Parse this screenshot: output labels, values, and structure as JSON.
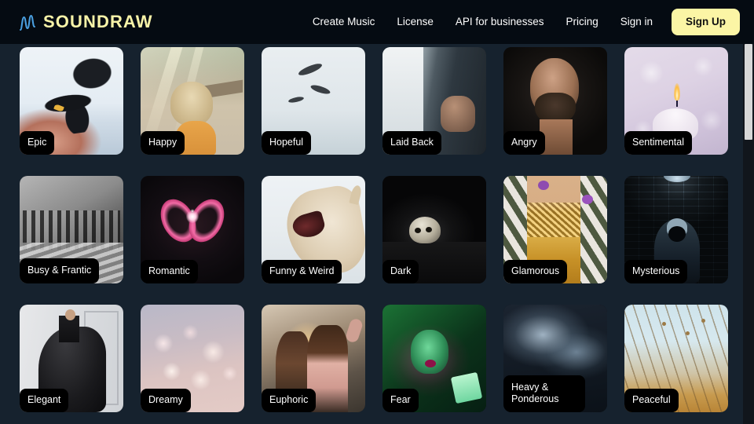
{
  "header": {
    "logo_text": "SOUNDRAW",
    "logo_mark_name": "waveform-icon",
    "nav": [
      {
        "label": "Create Music"
      },
      {
        "label": "License"
      },
      {
        "label": "API for businesses"
      },
      {
        "label": "Pricing"
      },
      {
        "label": "Sign in"
      }
    ],
    "signup_label": "Sign Up",
    "background_color": "#050b12",
    "logo_color": "#f8f3a8",
    "signup_color": "#fbf5a5"
  },
  "page": {
    "background_color": "#16222e"
  },
  "mood_grid": {
    "cards": [
      {
        "label": "Epic",
        "art": "art-epic"
      },
      {
        "label": "Happy",
        "art": "art-happy"
      },
      {
        "label": "Hopeful",
        "art": "art-hopeful"
      },
      {
        "label": "Laid Back",
        "art": "art-laidback"
      },
      {
        "label": "Angry",
        "art": "art-angry"
      },
      {
        "label": "Sentimental",
        "art": "art-sentimental"
      },
      {
        "label": "Busy & Frantic",
        "art": "art-busy"
      },
      {
        "label": "Romantic",
        "art": "art-romantic"
      },
      {
        "label": "Funny & Weird",
        "art": "art-funny"
      },
      {
        "label": "Dark",
        "art": "art-dark"
      },
      {
        "label": "Glamorous",
        "art": "art-glamorous"
      },
      {
        "label": "Mysterious",
        "art": "art-mysterious"
      },
      {
        "label": "Elegant",
        "art": "art-elegant"
      },
      {
        "label": "Dreamy",
        "art": "art-dreamy"
      },
      {
        "label": "Euphoric",
        "art": "art-euphoric"
      },
      {
        "label": "Fear",
        "art": "art-fear"
      },
      {
        "label": "Heavy & Ponderous",
        "art": "art-heavy"
      },
      {
        "label": "Peaceful",
        "art": "art-peaceful"
      }
    ]
  }
}
